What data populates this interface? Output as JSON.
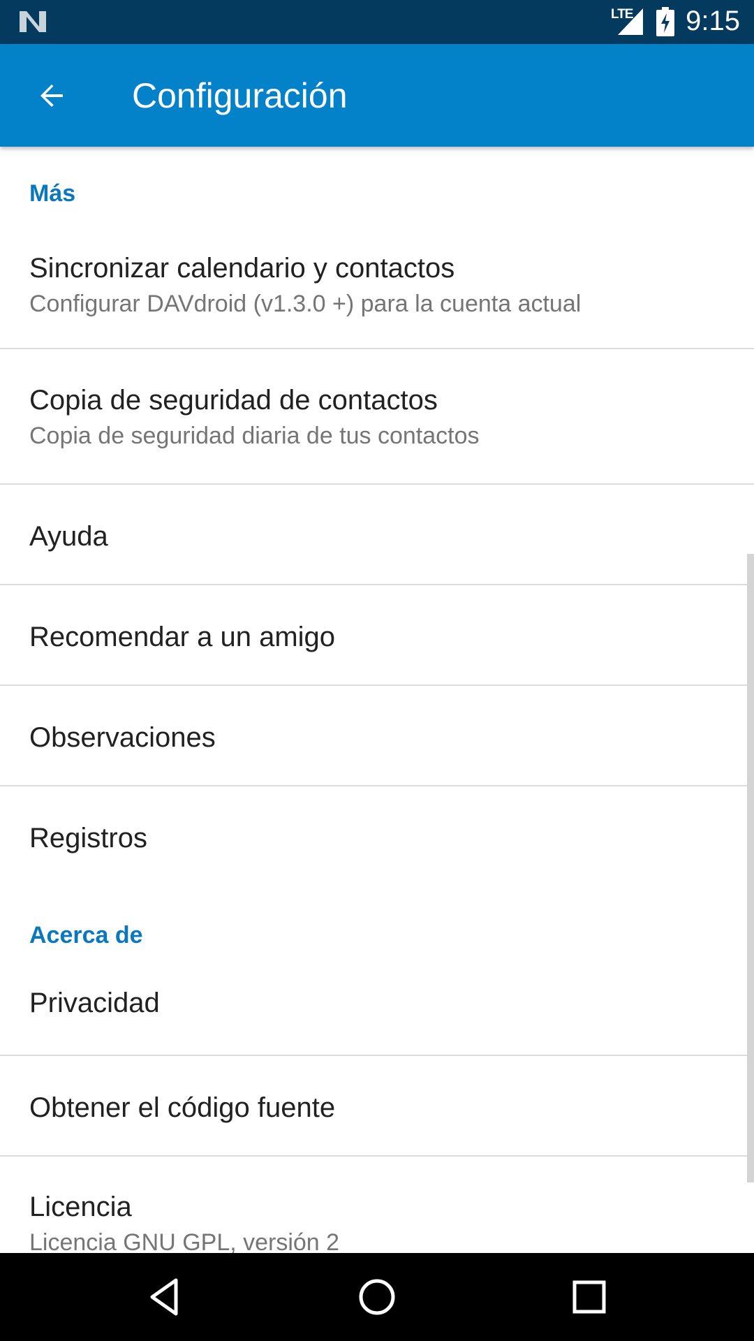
{
  "status_bar": {
    "network_label": "LTE",
    "time": "9:15",
    "icons": [
      "n-logo-icon",
      "signal-icon",
      "battery-charging-icon"
    ]
  },
  "app_bar": {
    "back_icon": "arrow-back-icon",
    "title": "Configuración",
    "background_color": "#0381c9"
  },
  "sections": {
    "more": {
      "header": "Más",
      "items": {
        "sync": {
          "title": "Sincronizar calendario y contactos",
          "summary": "Configurar DAVdroid (v1.3.0 +) para la cuenta actual"
        },
        "backup": {
          "title": "Copia de seguridad de contactos",
          "summary": "Copia de seguridad diaria de tus contactos"
        },
        "help": {
          "title": "Ayuda"
        },
        "recommend": {
          "title": "Recomendar a un amigo"
        },
        "feedback": {
          "title": "Observaciones"
        },
        "logs": {
          "title": "Registros"
        }
      }
    },
    "about": {
      "header": "Acerca de",
      "items": {
        "privacy": {
          "title": "Privacidad"
        },
        "source": {
          "title": "Obtener el código fuente"
        },
        "license": {
          "title": "Licencia",
          "summary": "Licencia GNU GPL, versión 2"
        }
      }
    }
  },
  "colors": {
    "status_bar": "#043a5e",
    "accent": "#0a78bd",
    "primary_text": "#212121",
    "secondary_text": "#757575"
  },
  "nav_bar": {
    "back_icon": "triangle-back-icon",
    "home_icon": "circle-home-icon",
    "recents_icon": "square-recents-icon"
  }
}
